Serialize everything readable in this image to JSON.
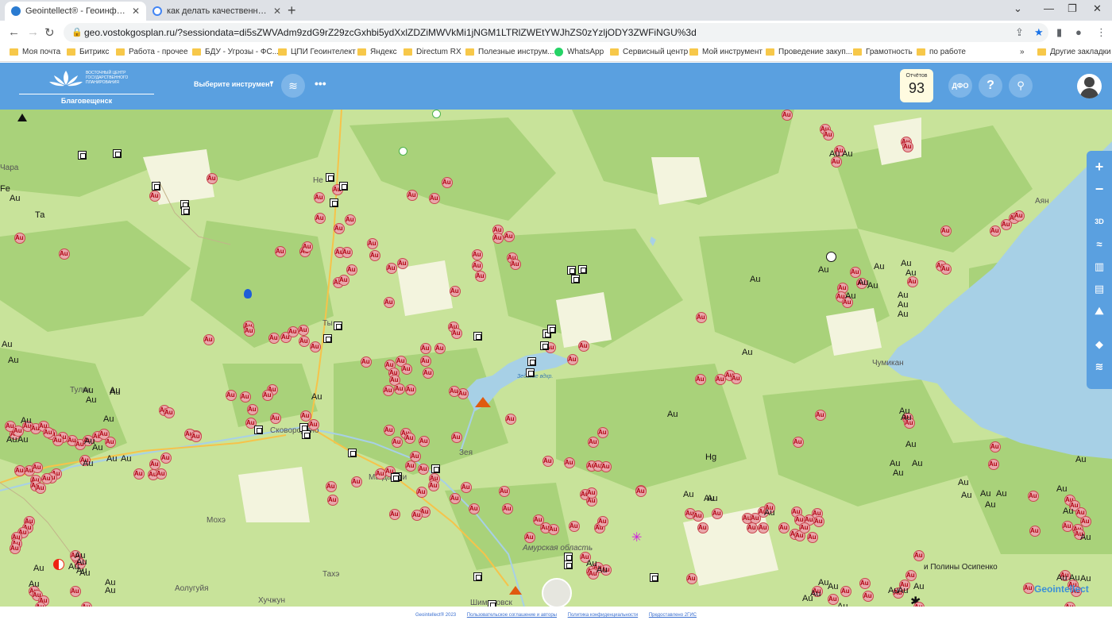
{
  "browser": {
    "tabs": [
      {
        "title": "Geointellect® - Геоинформацио",
        "active": true
      },
      {
        "title": "как делать качественные снимк",
        "active": false
      }
    ],
    "url": "geo.vostokgosplan.ru/?sessiondata=di5sZWVAdm9zdG9rZ29zcGxhbi5ydXxlZDZiMWVkMi1jNGM1LTRlZWEtYWJhZS0zYzljODY3ZWFiNGU%3d",
    "bookmarks": [
      "Моя почта",
      "Битрикс",
      "Работа - прочее",
      "БДУ - Угрозы - ФС...",
      "ЦПИ Геоинтелект",
      "Яндекс",
      "Directum RX",
      "Полезные инструм...",
      "WhatsApp",
      "Сервисный центр",
      "Мой инструмент",
      "Проведение закуп...",
      "Грамотность",
      "по работе",
      "Другие закладки"
    ]
  },
  "header": {
    "logo_text": "ВОСТОЧНЫЙ ЦЕНТР ГОСУДАРСТВЕННОГО ПЛАНИРОВАНИЯ",
    "city": "Благовещенск",
    "tool_select": "Выберите инструмент",
    "reports_label": "Отчётов",
    "reports_count": "93",
    "dfo": "ДФО",
    "help": "?"
  },
  "map": {
    "places": {
      "ayan": "Аян",
      "chumikan": "Чумикан",
      "zeya": "Зея",
      "magdagachi": "Магдагачи",
      "skovorodino": "Сковородино",
      "tynda": "Ты",
      "tulik": "Тулик",
      "mokhe": "Мохэ",
      "takhe": "Тахэ",
      "aoluguya": "Аолугуйя",
      "huzhong": "Хучжун",
      "shimanovsk": "Шимановск",
      "amur_oblast": "Амурская область",
      "zeya_reservoir": "Зейское вдхр.",
      "osipenko": "и Полины Осипенко",
      "chara": "Чара",
      "ta": "Та",
      "fe": "Fe",
      "nerungri": "Не",
      "hg": "Hg"
    },
    "pin_symbol": "Au",
    "side_controls": [
      "+",
      "−",
      "3D"
    ]
  },
  "watermark": "Geointellect",
  "footer": {
    "copyright": "Geointellect® 2023",
    "terms": "Пользовательское соглашение и авторы",
    "privacy": "Политика конфиденциальности",
    "provider": "Предоставлено 2ГИС"
  }
}
